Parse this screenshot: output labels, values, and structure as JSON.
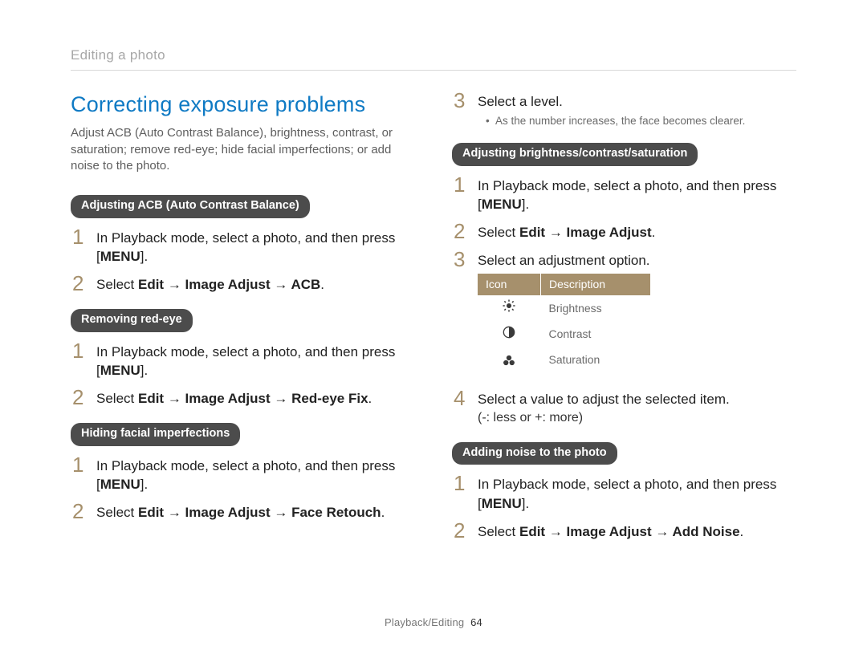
{
  "header": "Editing a photo",
  "title": "Correcting exposure problems",
  "intro": "Adjust ACB (Auto Contrast Balance), brightness, contrast, or saturation; remove red-eye; hide facial imperfections; or add noise to the photo.",
  "menu_label": "MENU",
  "sections": {
    "acb": {
      "heading": "Adjusting ACB (Auto Contrast Balance)",
      "step1": "In Playback mode, select a photo, and then press",
      "step2_prefix": "Select ",
      "step2_bold": "Edit → Image Adjust → ACB"
    },
    "redeye": {
      "heading": "Removing red-eye",
      "step1": "In Playback mode, select a photo, and then press",
      "step2_prefix": "Select ",
      "step2_bold": "Edit → Image Adjust → Red-eye Fix"
    },
    "face": {
      "heading": "Hiding facial imperfections",
      "step1": "In Playback mode, select a photo, and then press",
      "step2_prefix": "Select ",
      "step2_bold": "Edit → Image Adjust → Face Retouch"
    },
    "face_cont": {
      "step3": "Select a level.",
      "bullet": "As the number increases, the face becomes clearer."
    },
    "bcs": {
      "heading": "Adjusting brightness/contrast/saturation",
      "step1": "In Playback mode, select a photo, and then press",
      "step2_prefix": "Select ",
      "step2_bold": "Edit → Image Adjust",
      "step3": "Select an adjustment option.",
      "table_head_icon": "Icon",
      "table_head_desc": "Description",
      "rows": {
        "brightness": "Brightness",
        "contrast": "Contrast",
        "saturation": "Saturation"
      },
      "step4_line1": "Select a value to adjust the selected item.",
      "step4_line2": "(-: less or +: more)"
    },
    "noise": {
      "heading": "Adding noise to the photo",
      "step1": "In Playback mode, select a photo, and then press",
      "step2_prefix": "Select ",
      "step2_bold": "Edit → Image Adjust → Add Noise"
    }
  },
  "footer_section": "Playback/Editing",
  "footer_page": "64"
}
